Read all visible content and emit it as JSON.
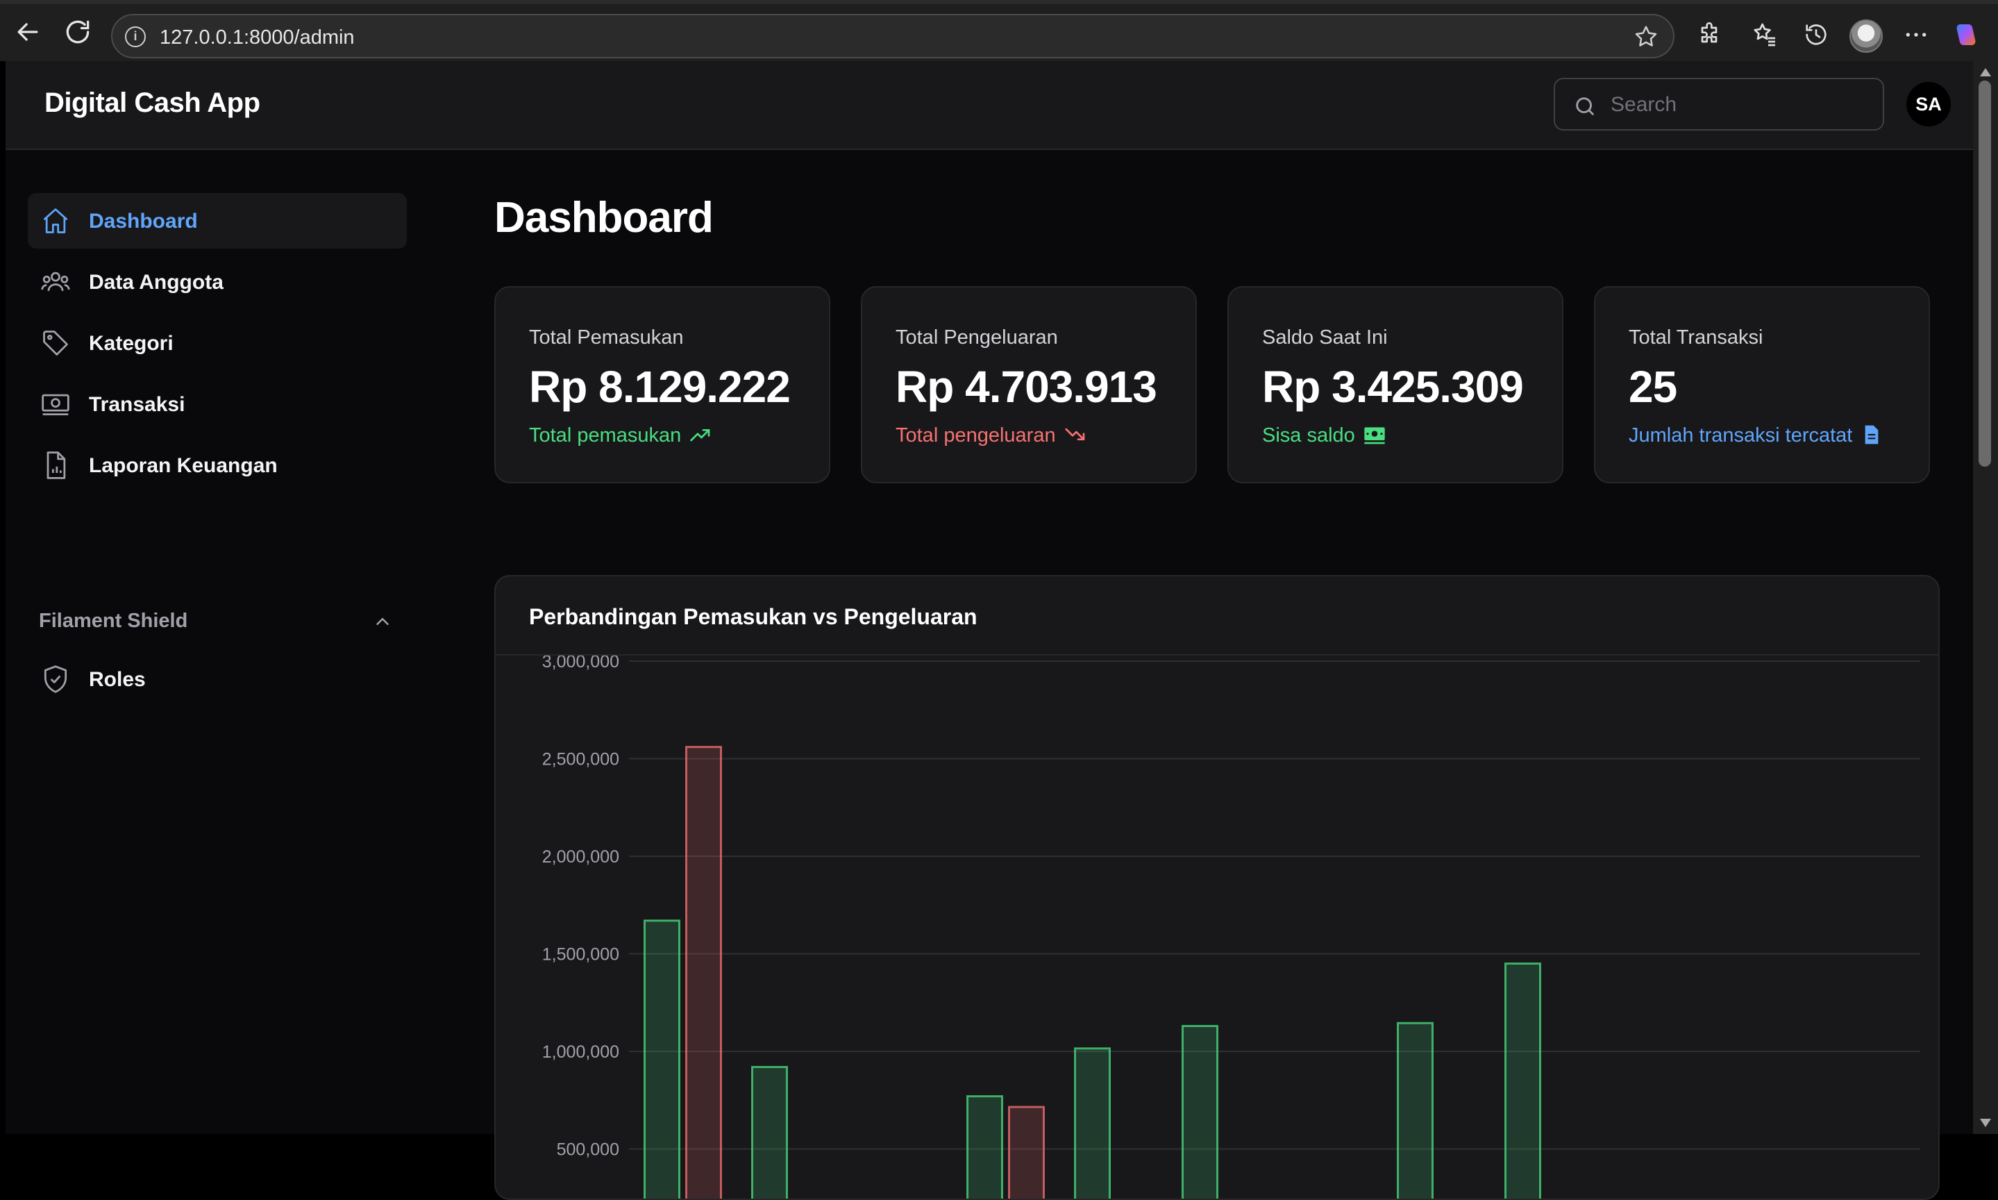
{
  "browser": {
    "url": "127.0.0.1:8000/admin"
  },
  "app": {
    "brand": "Digital Cash App",
    "search_placeholder": "Search",
    "avatar_initials": "SA"
  },
  "sidebar": {
    "items": [
      {
        "label": "Dashboard",
        "icon": "home-icon",
        "active": true
      },
      {
        "label": "Data Anggota",
        "icon": "users-icon",
        "active": false
      },
      {
        "label": "Kategori",
        "icon": "tag-icon",
        "active": false
      },
      {
        "label": "Transaksi",
        "icon": "banknote-icon",
        "active": false
      },
      {
        "label": "Laporan Keuangan",
        "icon": "report-icon",
        "active": false
      }
    ],
    "group_label": "Filament Shield",
    "group_items": [
      {
        "label": "Roles",
        "icon": "shield-icon"
      }
    ]
  },
  "page": {
    "title": "Dashboard"
  },
  "stats": [
    {
      "label": "Total Pemasukan",
      "value": "Rp 8.129.222",
      "description": "Total pemasukan",
      "icon": "trending-up-icon",
      "color": "#4ade80"
    },
    {
      "label": "Total Pengeluaran",
      "value": "Rp 4.703.913",
      "description": "Total pengeluaran",
      "icon": "trending-down-icon",
      "color": "#f87171"
    },
    {
      "label": "Saldo Saat Ini",
      "value": "Rp 3.425.309",
      "description": "Sisa saldo",
      "icon": "cash-icon",
      "color": "#4ade80"
    },
    {
      "label": "Total Transaksi",
      "value": "25",
      "description": "Jumlah transaksi tercatat",
      "icon": "document-icon",
      "color": "#60a5fa"
    }
  ],
  "chart_title": "Perbandingan Pemasukan vs Pengeluaran",
  "chart_data": {
    "type": "bar",
    "title": "Perbandingan Pemasukan vs Pengeluaran",
    "y_ticks": [
      "3,000,000",
      "2,500,000",
      "2,000,000",
      "1,500,000",
      "1,000,000",
      "500,000"
    ],
    "ylim": [
      500000,
      3000000
    ],
    "grid": true,
    "category_count": 12,
    "series": [
      {
        "color": "#4ade80",
        "values": [
          1670000,
          920000,
          0,
          770000,
          1015000,
          1130000,
          0,
          1145000,
          1450000,
          0,
          0,
          0
        ]
      },
      {
        "color": "#f87171",
        "values": [
          2560000,
          0,
          0,
          715000,
          0,
          0,
          0,
          0,
          0,
          0,
          0,
          0
        ]
      }
    ]
  }
}
